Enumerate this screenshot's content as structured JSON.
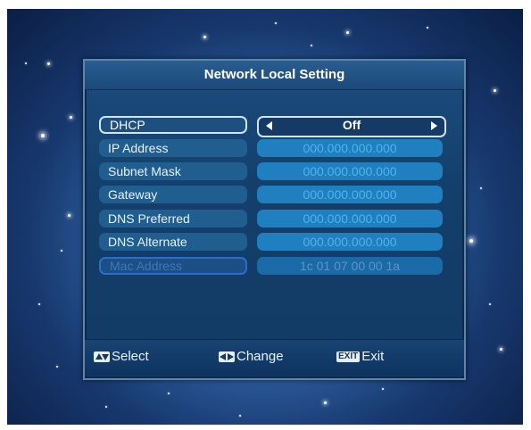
{
  "window": {
    "title": "Network Local Setting"
  },
  "rows": [
    {
      "label": "DHCP",
      "value": "Off"
    },
    {
      "label": "IP Address",
      "value": "000.000.000.000"
    },
    {
      "label": "Subnet Mask",
      "value": "000.000.000.000"
    },
    {
      "label": "Gateway",
      "value": "000.000.000.000"
    },
    {
      "label": "DNS Preferred",
      "value": "000.000.000.000"
    },
    {
      "label": "DNS Alternate",
      "value": "000.000.000.000"
    },
    {
      "label": "Mac Address",
      "value": "1c 01 07 00 00 1a"
    }
  ],
  "footer": {
    "select": "Select",
    "change": "Change",
    "exit_key": "EXIT",
    "exit": "Exit"
  },
  "colors": {
    "panel": "#143f6c",
    "value_field": "#1f7fbf",
    "label_field": "#1f5e8e",
    "highlight_border": "#cfe4f5"
  },
  "icons": {
    "select": "up-down-arrows-icon",
    "change": "left-right-arrows-icon",
    "exit": "exit-key-icon",
    "dhcp_prev": "triangle-left-icon",
    "dhcp_next": "triangle-right-icon"
  }
}
